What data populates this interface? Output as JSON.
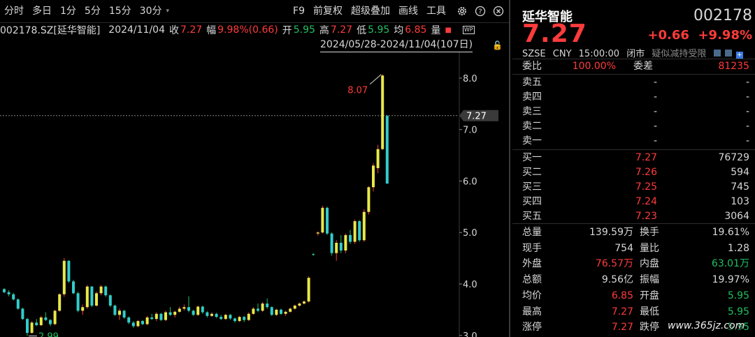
{
  "toolbar": {
    "items": [
      "分时",
      "多日",
      "1分",
      "5分",
      "15分",
      "30分"
    ],
    "more": "▾",
    "right": [
      "F9",
      "前复权",
      "超级叠加",
      "画线",
      "工具"
    ]
  },
  "info": {
    "code": "002178.SZ[延华智能]",
    "date": "2024/11/04",
    "close_label": "收",
    "close": "7.27",
    "amp_label": "幅",
    "amp": "9.98%(0.66)",
    "open_label": "开",
    "open": "5.95",
    "high_label": "高",
    "high": "7.27",
    "low_label": "低",
    "low": "5.95",
    "avg_label": "均",
    "avg": "6.85",
    "vol_label": "量",
    "range": "2024/05/28-2024/11/04(107日)"
  },
  "colors": {
    "up": "#ff3b3b",
    "down": "#20c060",
    "bull_bar": "#e8e84a",
    "bear_bar": "#33cccc",
    "bg": "#000000"
  },
  "chart_data": {
    "type": "candlestick",
    "y_ticks": [
      "8.0",
      "7.0",
      "6.0",
      "5.0",
      "4.0",
      "3.0"
    ],
    "ylim": [
      2.97,
      8.5
    ],
    "price_marker": "7.27",
    "high_annotation": "8.07",
    "low_annotation": "2.99",
    "candles": [
      {
        "o": 3.9,
        "h": 3.92,
        "l": 3.82,
        "c": 3.84
      },
      {
        "o": 3.84,
        "h": 3.88,
        "l": 3.76,
        "c": 3.8
      },
      {
        "o": 3.8,
        "h": 3.83,
        "l": 3.68,
        "c": 3.7
      },
      {
        "o": 3.7,
        "h": 3.72,
        "l": 3.5,
        "c": 3.52
      },
      {
        "o": 3.52,
        "h": 3.54,
        "l": 3.3,
        "c": 3.32
      },
      {
        "o": 3.32,
        "h": 3.34,
        "l": 2.99,
        "c": 3.05
      },
      {
        "o": 3.05,
        "h": 3.28,
        "l": 3.03,
        "c": 3.25
      },
      {
        "o": 3.25,
        "h": 3.32,
        "l": 3.18,
        "c": 3.2
      },
      {
        "o": 3.2,
        "h": 3.38,
        "l": 3.18,
        "c": 3.35
      },
      {
        "o": 3.35,
        "h": 3.45,
        "l": 3.28,
        "c": 3.3
      },
      {
        "o": 3.3,
        "h": 3.32,
        "l": 3.18,
        "c": 3.22
      },
      {
        "o": 3.22,
        "h": 3.5,
        "l": 3.2,
        "c": 3.48
      },
      {
        "o": 3.48,
        "h": 3.82,
        "l": 3.46,
        "c": 3.8
      },
      {
        "o": 3.8,
        "h": 4.5,
        "l": 3.75,
        "c": 4.45
      },
      {
        "o": 4.45,
        "h": 4.46,
        "l": 4.02,
        "c": 4.05
      },
      {
        "o": 4.05,
        "h": 4.08,
        "l": 3.8,
        "c": 3.82
      },
      {
        "o": 3.82,
        "h": 3.85,
        "l": 3.45,
        "c": 3.48
      },
      {
        "o": 3.48,
        "h": 3.6,
        "l": 3.4,
        "c": 3.55
      },
      {
        "o": 3.55,
        "h": 3.98,
        "l": 3.52,
        "c": 3.95
      },
      {
        "o": 3.95,
        "h": 3.96,
        "l": 3.55,
        "c": 3.58
      },
      {
        "o": 3.58,
        "h": 3.85,
        "l": 3.56,
        "c": 3.82
      },
      {
        "o": 3.82,
        "h": 3.98,
        "l": 3.78,
        "c": 3.95
      },
      {
        "o": 3.95,
        "h": 3.97,
        "l": 3.75,
        "c": 3.78
      },
      {
        "o": 3.78,
        "h": 3.8,
        "l": 3.55,
        "c": 3.58
      },
      {
        "o": 3.58,
        "h": 3.6,
        "l": 3.38,
        "c": 3.4
      },
      {
        "o": 3.4,
        "h": 3.52,
        "l": 3.3,
        "c": 3.48
      },
      {
        "o": 3.48,
        "h": 3.5,
        "l": 3.32,
        "c": 3.35
      },
      {
        "o": 3.35,
        "h": 3.37,
        "l": 3.22,
        "c": 3.25
      },
      {
        "o": 3.25,
        "h": 3.28,
        "l": 3.15,
        "c": 3.18
      },
      {
        "o": 3.18,
        "h": 3.3,
        "l": 3.16,
        "c": 3.28
      },
      {
        "o": 3.28,
        "h": 3.3,
        "l": 3.2,
        "c": 3.22
      },
      {
        "o": 3.22,
        "h": 3.38,
        "l": 3.2,
        "c": 3.35
      },
      {
        "o": 3.35,
        "h": 3.42,
        "l": 3.3,
        "c": 3.32
      },
      {
        "o": 3.32,
        "h": 3.45,
        "l": 3.28,
        "c": 3.42
      },
      {
        "o": 3.42,
        "h": 3.44,
        "l": 3.28,
        "c": 3.3
      },
      {
        "o": 3.3,
        "h": 3.48,
        "l": 3.28,
        "c": 3.45
      },
      {
        "o": 3.45,
        "h": 3.55,
        "l": 3.38,
        "c": 3.4
      },
      {
        "o": 3.4,
        "h": 3.48,
        "l": 3.35,
        "c": 3.46
      },
      {
        "o": 3.46,
        "h": 3.56,
        "l": 3.44,
        "c": 3.52
      },
      {
        "o": 3.52,
        "h": 3.6,
        "l": 3.48,
        "c": 3.55
      },
      {
        "o": 3.55,
        "h": 3.76,
        "l": 3.45,
        "c": 3.48
      },
      {
        "o": 3.48,
        "h": 3.5,
        "l": 3.38,
        "c": 3.4
      },
      {
        "o": 3.4,
        "h": 3.58,
        "l": 3.38,
        "c": 3.56
      },
      {
        "o": 3.56,
        "h": 3.58,
        "l": 3.42,
        "c": 3.45
      },
      {
        "o": 3.45,
        "h": 3.47,
        "l": 3.35,
        "c": 3.38
      },
      {
        "o": 3.38,
        "h": 3.45,
        "l": 3.36,
        "c": 3.42
      },
      {
        "o": 3.42,
        "h": 3.44,
        "l": 3.34,
        "c": 3.36
      },
      {
        "o": 3.36,
        "h": 3.4,
        "l": 3.3,
        "c": 3.32
      },
      {
        "o": 3.32,
        "h": 3.42,
        "l": 3.3,
        "c": 3.4
      },
      {
        "o": 3.4,
        "h": 3.42,
        "l": 3.3,
        "c": 3.33
      },
      {
        "o": 3.33,
        "h": 3.35,
        "l": 3.25,
        "c": 3.28
      },
      {
        "o": 3.28,
        "h": 3.38,
        "l": 3.26,
        "c": 3.36
      },
      {
        "o": 3.36,
        "h": 3.38,
        "l": 3.26,
        "c": 3.3
      },
      {
        "o": 3.3,
        "h": 3.45,
        "l": 3.28,
        "c": 3.42
      },
      {
        "o": 3.42,
        "h": 3.55,
        "l": 3.4,
        "c": 3.52
      },
      {
        "o": 3.52,
        "h": 3.62,
        "l": 3.45,
        "c": 3.48
      },
      {
        "o": 3.48,
        "h": 3.65,
        "l": 3.46,
        "c": 3.62
      },
      {
        "o": 3.62,
        "h": 3.72,
        "l": 3.52,
        "c": 3.55
      },
      {
        "o": 3.55,
        "h": 3.57,
        "l": 3.38,
        "c": 3.4
      },
      {
        "o": 3.4,
        "h": 3.52,
        "l": 3.38,
        "c": 3.5
      },
      {
        "o": 3.5,
        "h": 3.52,
        "l": 3.4,
        "c": 3.42
      },
      {
        "o": 3.42,
        "h": 3.48,
        "l": 3.38,
        "c": 3.46
      },
      {
        "o": 3.46,
        "h": 3.54,
        "l": 3.44,
        "c": 3.52
      },
      {
        "o": 3.52,
        "h": 3.6,
        "l": 3.5,
        "c": 3.58
      },
      {
        "o": 3.58,
        "h": 3.64,
        "l": 3.56,
        "c": 3.62
      },
      {
        "o": 3.62,
        "h": 3.68,
        "l": 3.6,
        "c": 3.66
      },
      {
        "o": 3.66,
        "h": 4.15,
        "l": 3.64,
        "c": 4.12
      },
      {
        "o": 4.58,
        "h": 4.6,
        "l": 4.55,
        "c": 4.57
      },
      {
        "o": 4.98,
        "h": 5.02,
        "l": 4.94,
        "c": 5.0
      },
      {
        "o": 5.0,
        "h": 5.52,
        "l": 4.98,
        "c": 5.48
      },
      {
        "o": 5.48,
        "h": 5.5,
        "l": 4.95,
        "c": 4.98
      },
      {
        "o": 4.98,
        "h": 5.0,
        "l": 4.55,
        "c": 4.6
      },
      {
        "o": 4.6,
        "h": 4.85,
        "l": 4.45,
        "c": 4.8
      },
      {
        "o": 4.8,
        "h": 4.95,
        "l": 4.6,
        "c": 4.65
      },
      {
        "o": 4.65,
        "h": 4.98,
        "l": 4.6,
        "c": 4.95
      },
      {
        "o": 4.95,
        "h": 5.05,
        "l": 4.78,
        "c": 4.82
      },
      {
        "o": 4.82,
        "h": 5.25,
        "l": 4.78,
        "c": 5.22
      },
      {
        "o": 5.22,
        "h": 5.24,
        "l": 4.82,
        "c": 4.85
      },
      {
        "o": 4.85,
        "h": 5.45,
        "l": 4.82,
        "c": 5.4
      },
      {
        "o": 5.4,
        "h": 5.9,
        "l": 5.35,
        "c": 5.88
      },
      {
        "o": 5.88,
        "h": 6.35,
        "l": 5.8,
        "c": 6.3
      },
      {
        "o": 6.25,
        "h": 6.7,
        "l": 6.15,
        "c": 6.62
      },
      {
        "o": 6.62,
        "h": 8.07,
        "l": 6.6,
        "c": 8.05
      },
      {
        "o": 7.27,
        "h": 7.27,
        "l": 5.95,
        "c": 5.95
      }
    ]
  },
  "quote": {
    "name": "延华智能",
    "code": "002178",
    "price": "7.27",
    "change": "+0.66",
    "change_pct": "+9.98%",
    "sub": [
      "SZSE",
      "CNY",
      "15:00:00",
      "闭市"
    ],
    "sub_note": "疑似减持受限",
    "weibi_label": "委比",
    "weibi": "100.00%",
    "weicha_label": "委差",
    "weicha": "81235",
    "asks": [
      {
        "label": "卖五",
        "price": "-",
        "vol": "-"
      },
      {
        "label": "卖四",
        "price": "-",
        "vol": "-"
      },
      {
        "label": "卖三",
        "price": "-",
        "vol": "-"
      },
      {
        "label": "卖二",
        "price": "-",
        "vol": "-"
      },
      {
        "label": "卖一",
        "price": "-",
        "vol": "-"
      }
    ],
    "bids": [
      {
        "label": "买一",
        "price": "7.27",
        "vol": "76729"
      },
      {
        "label": "买二",
        "price": "7.26",
        "vol": "594"
      },
      {
        "label": "买三",
        "price": "7.25",
        "vol": "745"
      },
      {
        "label": "买四",
        "price": "7.24",
        "vol": "103"
      },
      {
        "label": "买五",
        "price": "7.23",
        "vol": "3064"
      }
    ],
    "stats": [
      {
        "l1": "总量",
        "v1": "139.59万",
        "c1": "w",
        "l2": "换手",
        "v2": "19.61%",
        "c2": "w"
      },
      {
        "l1": "现手",
        "v1": "754",
        "c1": "w",
        "l2": "量比",
        "v2": "1.28",
        "c2": "w"
      },
      {
        "l1": "外盘",
        "v1": "76.57万",
        "c1": "r",
        "l2": "内盘",
        "v2": "63.01万",
        "c2": "g"
      },
      {
        "l1": "总额",
        "v1": "9.56亿",
        "c1": "w",
        "l2": "振幅",
        "v2": "19.97%",
        "c2": "w"
      },
      {
        "l1": "均价",
        "v1": "6.85",
        "c1": "r",
        "l2": "开盘",
        "v2": "5.95",
        "c2": "g"
      },
      {
        "l1": "最高",
        "v1": "7.27",
        "c1": "r",
        "l2": "最低",
        "v2": "5.95",
        "c2": "g"
      },
      {
        "l1": "涨停",
        "v1": "7.27",
        "c1": "r",
        "l2": "跌停",
        "v2": "5.95",
        "c2": "g"
      }
    ]
  },
  "watermark": "www.365jz.com"
}
